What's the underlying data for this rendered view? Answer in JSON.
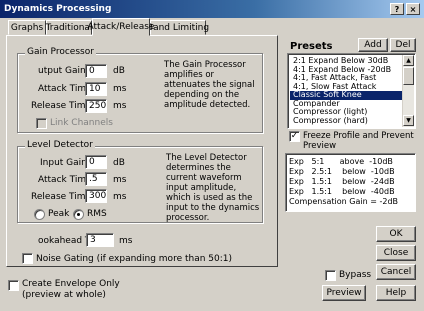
{
  "window": {
    "title": "Dynamics Processing",
    "help_glyph": "?",
    "close_glyph": "×"
  },
  "tabs": [
    "Graphs",
    "Traditional",
    "Attack/Release",
    "Band Limiting"
  ],
  "gain_processor": {
    "legend": "Gain Processor",
    "output_gain": {
      "label": "utput Gain",
      "value": "0",
      "unit": "dB"
    },
    "attack": {
      "label": "Attack Time",
      "value": "10",
      "unit": "ms"
    },
    "release": {
      "label": "Release Time",
      "value": "250",
      "unit": "ms"
    },
    "link_channels": {
      "label": "Link Channels",
      "checked": false
    },
    "description": "The Gain Processor amplifies or attenuates the signal depending on the amplitude detected."
  },
  "level_detector": {
    "legend": "Level Detector",
    "input_gain": {
      "label": "Input Gain",
      "value": "0",
      "unit": "dB"
    },
    "attack": {
      "label": "Attack Time",
      "value": ".5",
      "unit": "ms"
    },
    "release": {
      "label": "Release Time",
      "value": "300",
      "unit": "ms"
    },
    "description": "The Level Detector determines the current waveform input amplitude, which is used as the input to the dynamics processor.",
    "peak": {
      "label": "Peak",
      "selected": false
    },
    "rms": {
      "label": "RMS",
      "selected": true
    }
  },
  "lookahead": {
    "label": "ookahead Time",
    "value": "3",
    "unit": "ms"
  },
  "noise_gating": {
    "label": "Noise Gating (if expanding more than 50:1)",
    "checked": false
  },
  "create_envelope": {
    "label": "Create Envelope Only",
    "sublabel": "(preview at whole)",
    "checked": false
  },
  "presets": {
    "title": "Presets",
    "add_label": "Add",
    "del_label": "Del",
    "items": [
      "2:1 Expand Below 30dB",
      "4:1 Expand Below -20dB",
      "4:1, Fast Attack, Fast",
      "4:1, Slow Fast Attack",
      "Classic Soft Knee",
      "Compander",
      "Compressor (light)",
      "Compressor (hard)"
    ],
    "selected_index": 4,
    "freeze_mode": {
      "label": "Freeze Profile and Prevent Preview",
      "checked": true
    }
  },
  "summary": {
    "lines": [
      "Exp   5:1      above  -10dB",
      "Exp   2.5:1    below  -10dB",
      "Exp   1.5:1    below  -24dB",
      "Exp   1.5:1    below  -40dB",
      "Compensation Gain = -2dB"
    ]
  },
  "buttons": {
    "ok": "OK",
    "close": "Close",
    "cancel": "Cancel",
    "preview": "Preview",
    "help": "Help"
  },
  "bypass": {
    "label": "Bypass",
    "checked": false
  }
}
